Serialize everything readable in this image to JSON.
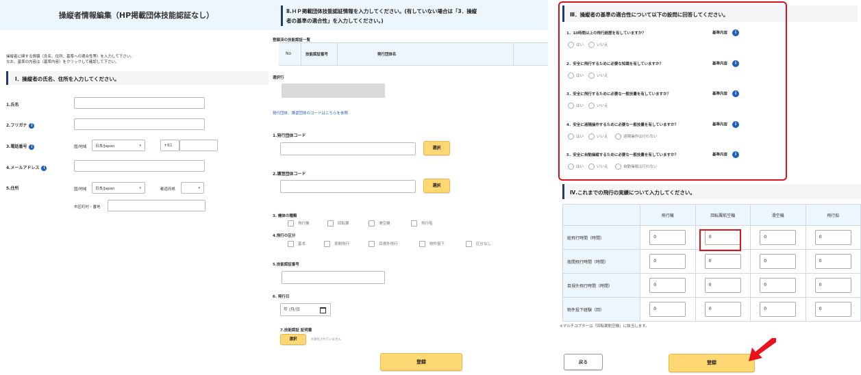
{
  "panel1": {
    "title": "操縦者情報編集（HP掲載団体技能認証なし）",
    "intro_line1": "操縦者に関する情報（氏名、住所、基準への適合性等）を入力して下さい。",
    "intro_line2": "なお、基準の内容は（基準内容）をクリックして確認して下さい。",
    "section1_title": "Ⅰ．操縦者の氏名、住所を入力してください。",
    "name_label": "1.氏名",
    "furigana_label": "2.フリガナ",
    "phone_label": "3.電話番号",
    "phone_country_label": "国/地域",
    "phone_country_value": "日本/Japan",
    "phone_code": "+81",
    "email_label": "4.メールアドレス",
    "address_label": "5.住所",
    "addr_country_label": "国/地域",
    "addr_country_value": "日本/Japan",
    "pref_label": "都道府県",
    "city_label": "市区町村・番地"
  },
  "panel2": {
    "title_line1": "Ⅱ.ＨＰ掲載団体技能認証情報を入力してください。(有していない場合は「3．操縦",
    "title_line2": "者の基準の適合性」を入力してください。)",
    "registered_title": "登録済の技能認証一覧",
    "col_no": "No",
    "col_cert": "技能認証番号",
    "col_org": "発行団体名",
    "selected_row_label": "選択行",
    "org_link": "発行団体、講習団体のコードはこちらを参照",
    "issuer_code_label": "1.発行団体コード",
    "course_code_label": "2.講習団体コード",
    "select_btn": "選択",
    "aircraft_type_label": "3. 機体の種類",
    "aircraft_types": [
      "飛行機",
      "回転翼",
      "滑空機",
      "飛行船"
    ],
    "flight_class_label": "4.飛行の区分",
    "flight_classes": [
      "基本",
      "夜間飛行",
      "目視外飛行",
      "物件投下",
      "区分なし"
    ],
    "cert_number_label": "5.技能認証番号",
    "issue_date_label": "6. 発行日",
    "date_placeholder": "年 /月/日",
    "certificate_label": "7.技能認証 証明書",
    "certificate_btn": "選択",
    "no_file_text": "※添付されていません",
    "register_btn": "登録"
  },
  "panel3": {
    "section3_title": "Ⅲ．操縦者の基準の適合性について以下の設問に回答してください。",
    "criteria_link": "基準内容",
    "questions": [
      {
        "text": "1．10時間以上の飛行経歴を有していますか？",
        "opts": [
          "はい",
          "いいえ"
        ]
      },
      {
        "text": "2．安全に飛行するために必要な知識を有していますか？",
        "opts": [
          "はい",
          "いいえ"
        ]
      },
      {
        "text": "3．安全に飛行するために必要な一般技量を有していますか？",
        "opts": [
          "はい",
          "いいえ"
        ]
      },
      {
        "text": "4．安全に遠隔操作するために必要な一般技量を有していますか？",
        "opts": [
          "はい",
          "いいえ",
          "遠隔操作は行わない"
        ]
      },
      {
        "text": "5．安全に自動操縦するために必要な一般技量を有していますか？",
        "opts": [
          "はい",
          "いいえ",
          "自動操縦は行わない"
        ]
      }
    ],
    "section4_title": "Ⅳ.これまでの飛行の実績について入力してください。",
    "columns": [
      "飛行機",
      "回転翼航空機",
      "滑空機",
      "飛行船"
    ],
    "rows": [
      {
        "label": "総飛行時間（時間）",
        "values": [
          "0",
          "0",
          "0",
          "0"
        ]
      },
      {
        "label": "夜間飛行時間（時間）",
        "values": [
          "0",
          "0",
          "0",
          "0"
        ]
      },
      {
        "label": "目視外飛行時間（時間）",
        "values": [
          "0",
          "0",
          "0",
          "0"
        ]
      },
      {
        "label": "物件投下経験（回）",
        "values": [
          "0",
          "0",
          "0",
          "0"
        ]
      }
    ],
    "note": "※マルチコプターは「回転翼航空機」に該当します。",
    "back_btn": "戻る",
    "register_btn": "登録",
    "highlight_color": "#d9121b",
    "accent_color": "#ffd873"
  }
}
